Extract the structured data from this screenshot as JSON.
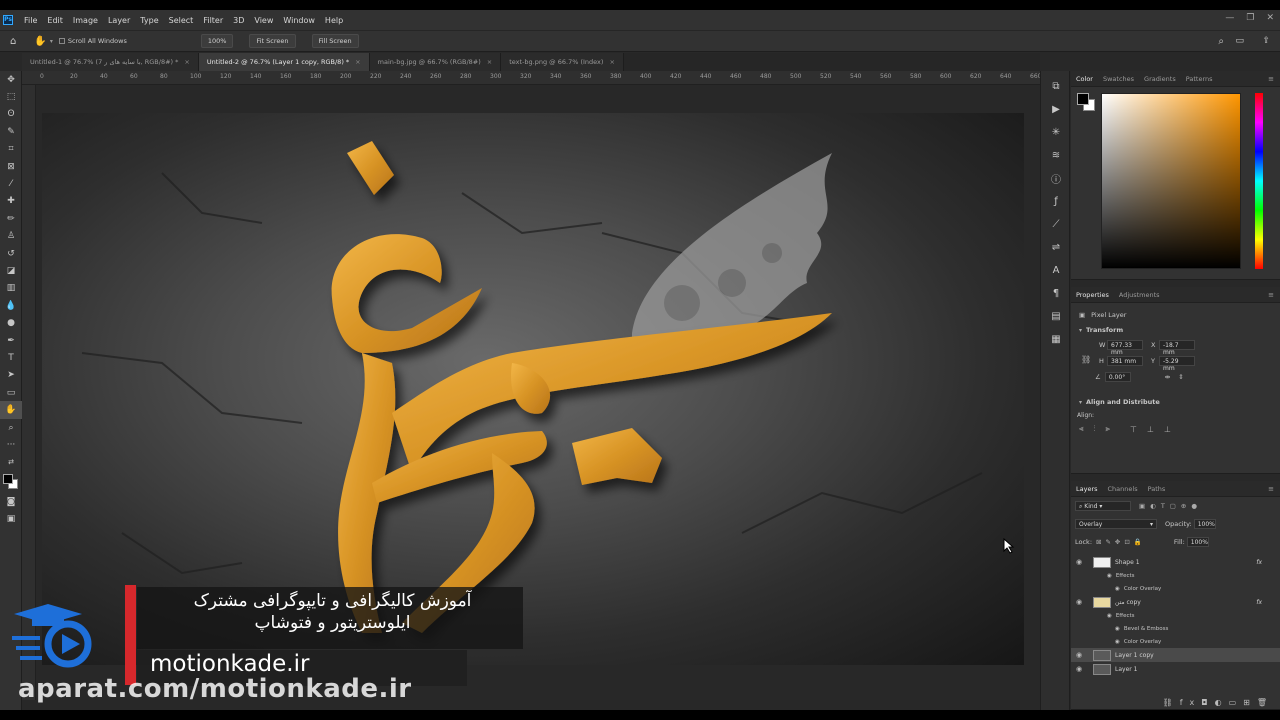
{
  "menu": [
    "File",
    "Edit",
    "Image",
    "Layer",
    "Type",
    "Select",
    "Filter",
    "3D",
    "View",
    "Window",
    "Help"
  ],
  "options_bar": {
    "scroll_all_windows": "Scroll All Windows",
    "zoom_button": "100%",
    "fit_screen": "Fit Screen",
    "fill_screen": "Fill Screen"
  },
  "doc_tabs": [
    {
      "label": "Untitled-1 @ 76.7% (7 با سایه های ر, RGB/8#) *",
      "active": false
    },
    {
      "label": "Untitled-2 @ 76.7% (Layer 1 copy, RGB/8) *",
      "active": true
    },
    {
      "label": "main-bg.jpg @ 66.7% (RGB/8#)",
      "active": false
    },
    {
      "label": "text-bg.png @ 66.7% (Index)",
      "active": false
    }
  ],
  "ruler_ticks": [
    "0",
    "20",
    "40",
    "60",
    "80",
    "100",
    "120",
    "140",
    "160",
    "180",
    "200",
    "220",
    "240",
    "260",
    "280",
    "300",
    "320",
    "340",
    "360",
    "380",
    "400",
    "420",
    "440",
    "460",
    "480",
    "500",
    "520",
    "540",
    "560",
    "580",
    "600",
    "620",
    "640",
    "660"
  ],
  "color_panel": {
    "tabs": [
      "Color",
      "Swatches",
      "Gradients",
      "Patterns"
    ],
    "hue_color": "#ff9600"
  },
  "properties_panel": {
    "tabs": [
      "Properties",
      "Adjustments"
    ],
    "layer_type": "Pixel Layer",
    "transform_label": "Transform",
    "w_label": "W",
    "w_value": "677.33 mm",
    "x_label": "X",
    "x_value": "-18.7 mm",
    "h_label": "H",
    "h_value": "381 mm",
    "y_label": "Y",
    "y_value": "-5.29 mm",
    "angle_value": "0.00°",
    "align_label": "Align and Distribute",
    "align_sub": "Align:"
  },
  "layers_panel": {
    "tabs": [
      "Layers",
      "Channels",
      "Paths"
    ],
    "kind_label": "Kind",
    "blend_mode": "Overlay",
    "opacity_label": "Opacity:",
    "opacity_value": "100%",
    "lock_label": "Lock:",
    "fill_label": "Fill:",
    "fill_value": "100%",
    "layers": [
      {
        "name": "Shape 1",
        "fx": "fx",
        "effects_label": "Effects",
        "effects": [
          "Color Overlay"
        ]
      },
      {
        "name": "متن copy",
        "fx": "fx",
        "effects_label": "Effects",
        "effects": [
          "Bevel & Emboss",
          "Color Overlay"
        ]
      },
      {
        "name": "Layer 1 copy",
        "selected": true
      },
      {
        "name": "Layer 1"
      }
    ]
  },
  "overlay": {
    "title_line1": "آموزش کالیگرافی و تایپوگرافی مشترک",
    "title_line2": "ایلوستریتور و فتوشاپ",
    "site": "motionkade.ir",
    "watermark": "aparat.com/motionkade.ir"
  }
}
